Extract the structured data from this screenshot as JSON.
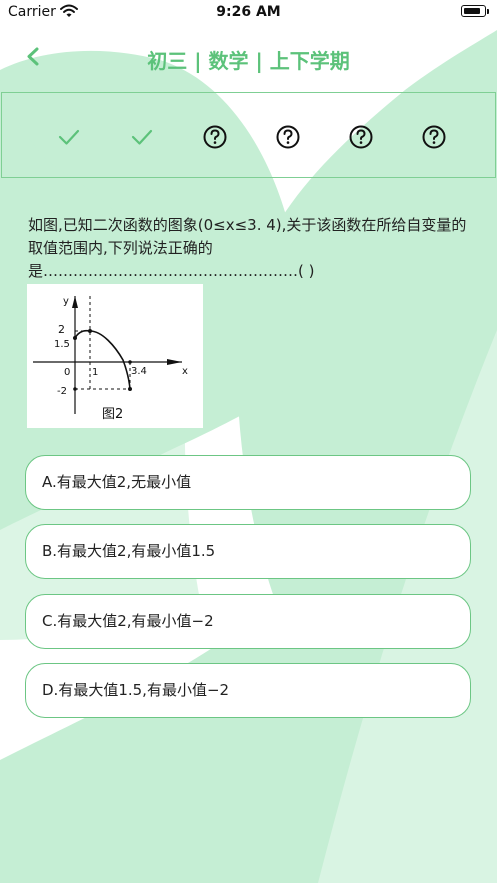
{
  "status_bar": {
    "carrier": "Carrier",
    "time": "9:26 AM",
    "battery_level": 0.85
  },
  "nav": {
    "back_icon": "chevron-left-icon",
    "title": "初三 | 数学 | 上下学期"
  },
  "progress": {
    "steps": [
      {
        "state": "answered",
        "icon": "check-icon"
      },
      {
        "state": "answered",
        "icon": "check-icon"
      },
      {
        "state": "unanswered",
        "icon": "question-circle-icon"
      },
      {
        "state": "unanswered",
        "icon": "question-circle-icon"
      },
      {
        "state": "unanswered",
        "icon": "question-circle-icon"
      },
      {
        "state": "unanswered",
        "icon": "question-circle-icon"
      }
    ]
  },
  "question": {
    "text": "如图,已知二次函数的图象(0≤x≤3. 4),关于该函数在所给自变量的取值范围内,下列说法正确的是……………………………………………( )",
    "figure": {
      "tick_labels": {
        "y_axis": "y",
        "x_axis": "x",
        "y2": "2",
        "y15": "1.5",
        "origin": "0",
        "x1": "1",
        "x34": "3.4",
        "yneg2": "-2"
      },
      "caption": "图2"
    }
  },
  "options": [
    {
      "label": "A.有最大值2,无最小值"
    },
    {
      "label": "B.有最大值2,有最小值1.5"
    },
    {
      "label": "C.有最大值2,有最小值−2"
    },
    {
      "label": "D.有最大值1.5,有最小值−2"
    }
  ],
  "colors": {
    "accent": "#5cc27a",
    "background_shape": "#c5eed4",
    "border": "#7fcf94"
  }
}
